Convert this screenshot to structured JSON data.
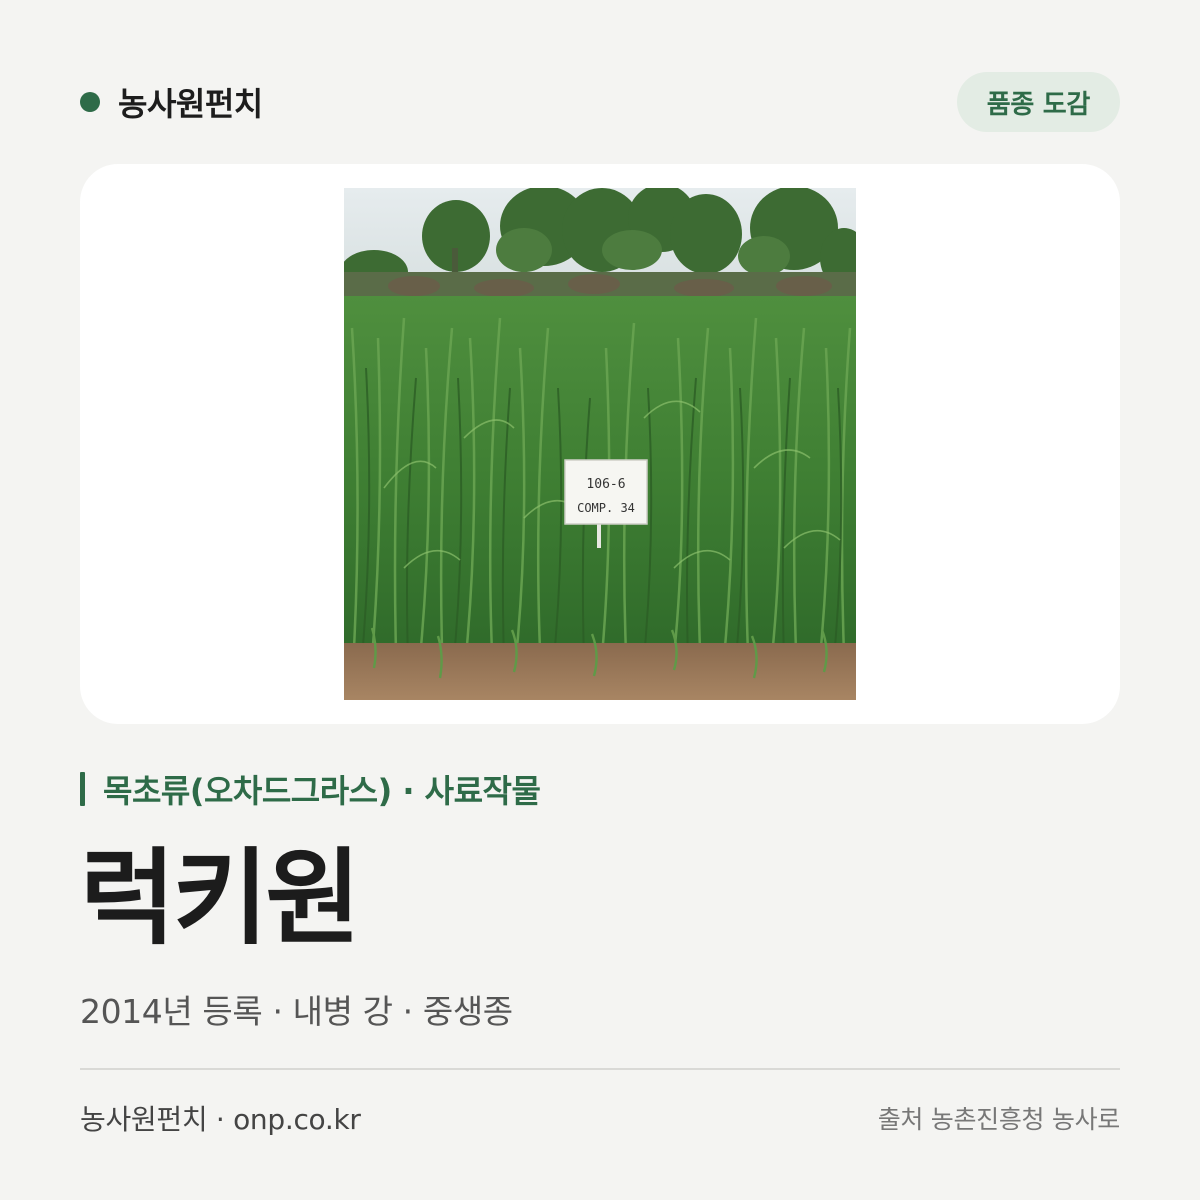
{
  "header": {
    "brand_name": "농사원펀치",
    "badge_label": "품종 도감"
  },
  "photo": {
    "sign_line1": "106-6",
    "sign_line2": "COMP. 34"
  },
  "variety": {
    "category": "목초류(오차드그라스) · 사료작물",
    "name": "럭키원",
    "details": "2014년 등록 · 내병 강 · 중생종"
  },
  "footer": {
    "left": "농사원펀치 · onp.co.kr",
    "right": "출처 농촌진흥청 농사로"
  },
  "colors": {
    "accent": "#2e6b48",
    "badge_bg": "#e3ece4",
    "background": "#f4f4f2",
    "card": "#ffffff"
  }
}
